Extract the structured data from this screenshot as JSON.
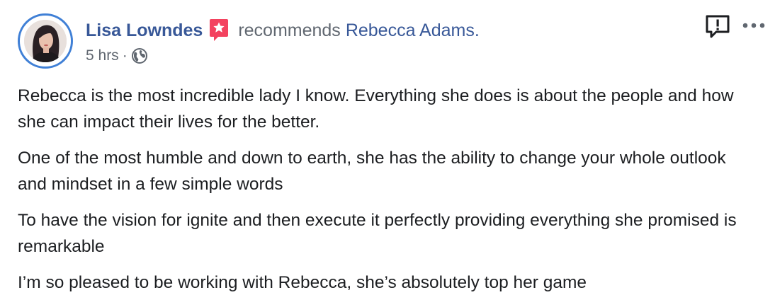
{
  "post": {
    "author": "Lisa Lowndes",
    "verb": "recommends",
    "target": "Rebecca Adams.",
    "time": "5 hrs",
    "separator": "·",
    "audience_icon": "globe-icon",
    "recommend_icon": "star-badge-icon",
    "paragraphs": [
      "Rebecca is the most incredible lady I know. Everything she does is about the people and how she can impact their lives for the better.",
      "One of the most humble and down to earth, she has the ability to change your whole outlook and mindset in a few simple words",
      "To have the vision for ignite and then execute it perfectly providing everything she promised is remarkable",
      "I’m so pleased to be working with Rebecca, she’s absolutely top her game"
    ]
  },
  "actions": {
    "report_icon": "report-icon",
    "more_icon": "more-options-icon"
  },
  "colors": {
    "link": "#385898",
    "secondary_text": "#606770",
    "primary_text": "#1c1e21",
    "avatar_ring": "#4080d6",
    "recommend_badge": "#f3425f"
  }
}
